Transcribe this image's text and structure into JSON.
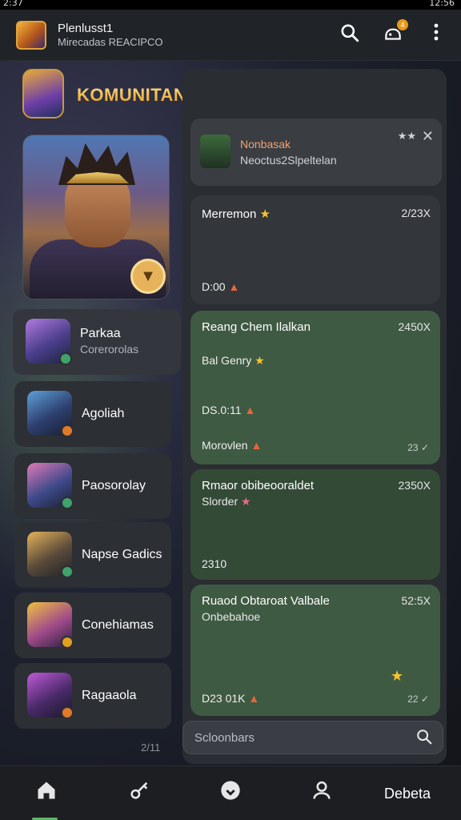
{
  "status": {
    "left": "2:37",
    "right": "12:56"
  },
  "appbar": {
    "title": "Plenlusst1",
    "subtitle": "Mirecadas REACIPCO",
    "notif_count": "4"
  },
  "header": {
    "title": "KOMUNITAN IGAME :"
  },
  "left_list": [
    {
      "name": "Parkaa",
      "sub": "Corerorolas",
      "dot": "#3fa36b"
    },
    {
      "name": "Agoliah",
      "sub": "",
      "dot": "#e07a2a"
    },
    {
      "name": "Paosorolay",
      "sub": "",
      "dot": "#3fa36b"
    },
    {
      "name": "Napse Gadics",
      "sub": "",
      "dot": "#3fa36b"
    },
    {
      "name": "Conehiamas",
      "sub": "",
      "dot": "#e0a21c"
    },
    {
      "name": "Ragaaola",
      "sub": "",
      "dot": "#e07a2a"
    }
  ],
  "left_footer": "2/11",
  "top_notification": {
    "title": "Nonbasak",
    "text": "Neoctus2Slpeltelan",
    "stars": "★★"
  },
  "messages": [
    {
      "title": "Merremon",
      "amount": "2/23X",
      "line1": "D:00"
    },
    {
      "title": "Reang Chem Ilalkan",
      "amount": "2450X",
      "line1": "Bal Genry",
      "line2": "DS.0:11",
      "line3": "Morovlen",
      "tick": "23"
    },
    {
      "title": "Rmaor obibeooraldet",
      "subtitle": "Slorder",
      "amount": "2350X",
      "line1": "2310"
    },
    {
      "title": "Ruaod Obtaroat Valbale",
      "subtitle": "Onbebahoe",
      "amount": "52:5X",
      "line1": "D23 01K",
      "tick": "22"
    }
  ],
  "search": {
    "placeholder": "Scloonbars"
  },
  "bottom_nav": {
    "label": "Debeta"
  },
  "colors": {
    "accent_green": "#5fb56a",
    "title_gold": "#e49a1e",
    "card_green": "#3f5a42"
  }
}
